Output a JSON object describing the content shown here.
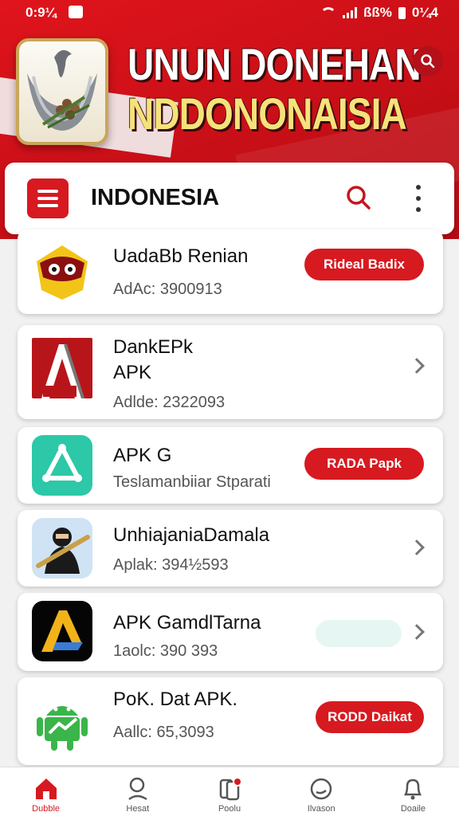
{
  "status_bar": {
    "time": "0:9¼",
    "battery": "ßß%",
    "clock_right": "0¼4"
  },
  "banner": {
    "title_line1": "UNUN DONEHAN",
    "title_line2": "NDDONONAISIA",
    "logo_icon": "garuda-emblem-icon",
    "search_icon": "search-icon"
  },
  "appbar": {
    "title": "INDONESIA",
    "menu_icon": "hamburger-menu-icon",
    "search_icon": "search-icon",
    "more_icon": "more-vertical-icon"
  },
  "apps": [
    {
      "name": "UadaBb Renian",
      "sub": "AdAc: 3900913",
      "action": "Rideal Badix",
      "icon": "masked-face-icon"
    },
    {
      "name": "DankEPk\nAPK",
      "sub": "Adlde: 2322093",
      "action": null,
      "icon": "apk-a-logo-icon"
    },
    {
      "name": "APK G",
      "sub": "Teslamanbiiar Stparati",
      "action": "RADA Papk",
      "icon": "app-store-icon"
    },
    {
      "name": "UnhiajaniaDamala",
      "sub": "Aplak: 394½593",
      "action": null,
      "icon": "ninja-icon"
    },
    {
      "name": "APK GamdlTarna",
      "sub": "1aolc: 390 393",
      "action": null,
      "icon": "apk-gold-a-icon"
    },
    {
      "name": "PoK. Dat APK.",
      "sub": "Aallc: 65,3093",
      "action": "RODD Daikat",
      "icon": "android-robot-icon"
    }
  ],
  "bottom_nav": [
    {
      "label": "Dubble",
      "icon": "home-icon",
      "active": true
    },
    {
      "label": "Hesat",
      "icon": "search-icon",
      "active": false
    },
    {
      "label": "Poolu",
      "icon": "library-icon",
      "active": false
    },
    {
      "label": "Ilvason",
      "icon": "clock-icon",
      "active": false
    },
    {
      "label": "Doaile",
      "icon": "bell-icon",
      "active": false
    }
  ],
  "colors": {
    "brand_red": "#d71920",
    "gold": "#f6e27a"
  }
}
